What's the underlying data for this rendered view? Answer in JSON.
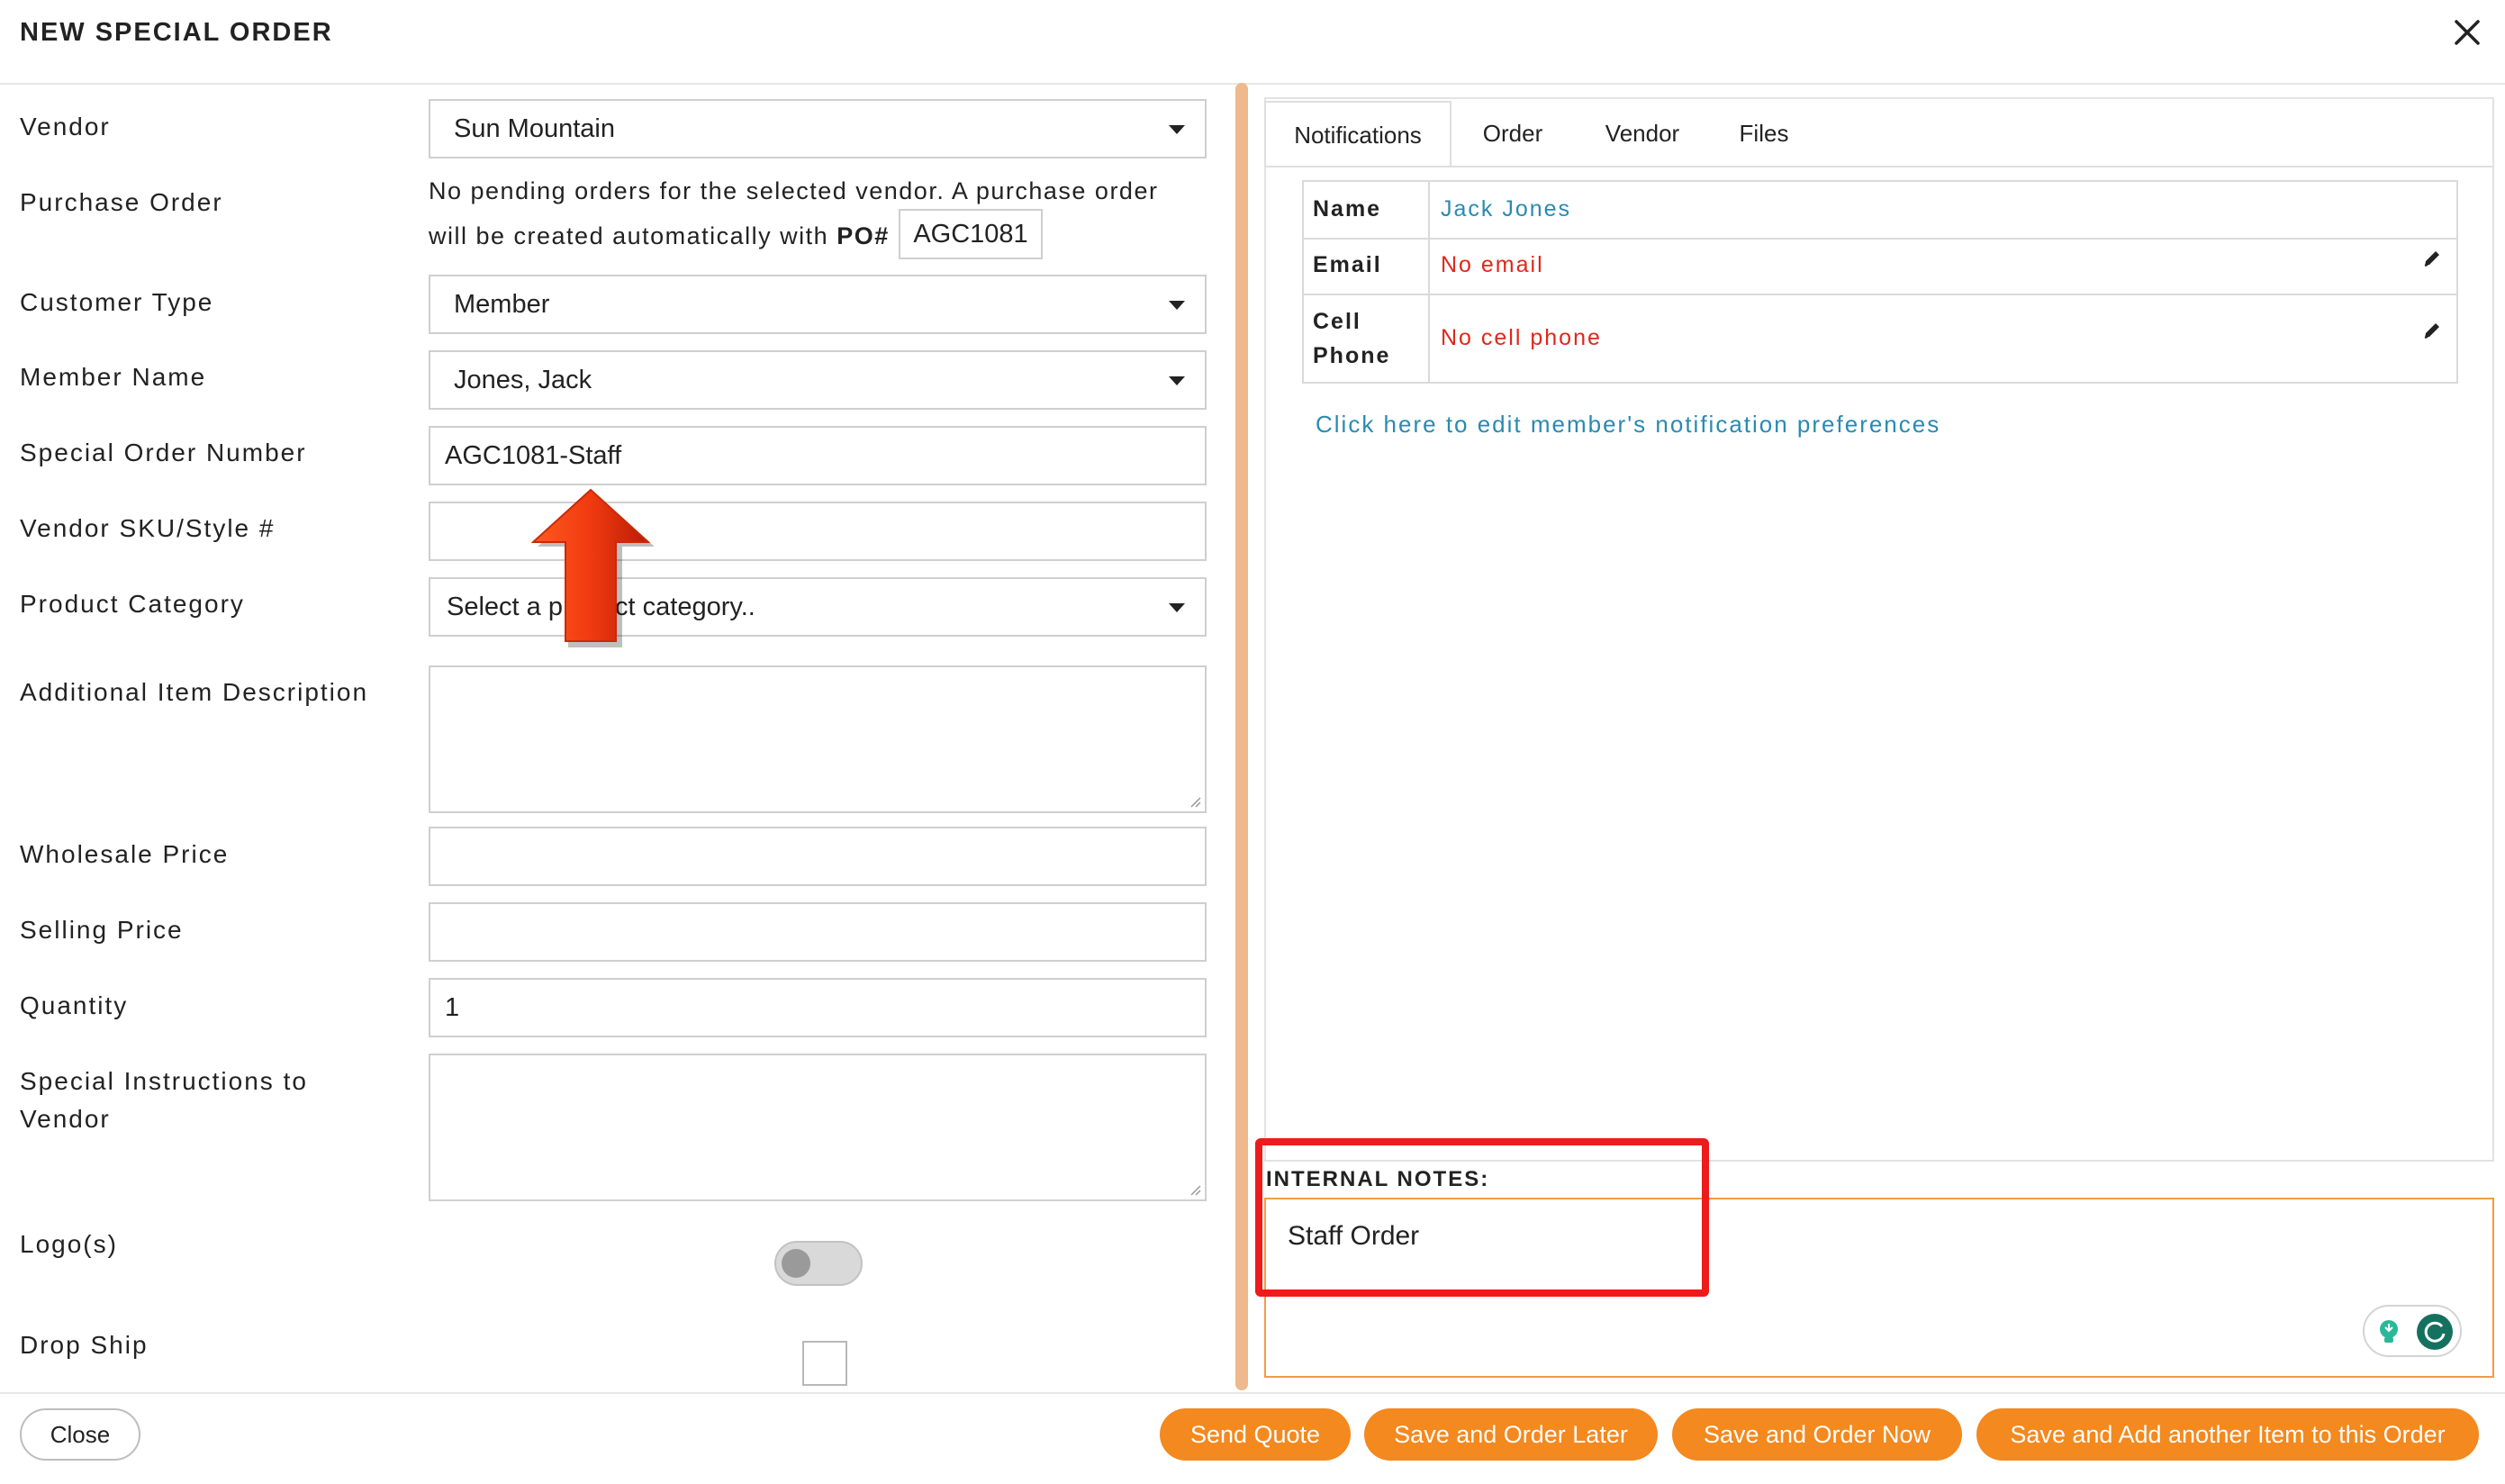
{
  "header": {
    "title": "NEW SPECIAL ORDER"
  },
  "form": {
    "vendor": {
      "label": "Vendor",
      "value": "Sun Mountain"
    },
    "purchase_order": {
      "label": "Purchase Order",
      "text_line1": "No pending orders for the selected vendor. A purchase order",
      "text_line2": "will be created automatically with",
      "po_prefix": "PO#",
      "po_number": "AGC1081"
    },
    "customer_type": {
      "label": "Customer Type",
      "value": "Member"
    },
    "member_name": {
      "label": "Member Name",
      "value": "Jones, Jack"
    },
    "special_order_number": {
      "label": "Special Order Number",
      "value": "AGC1081-Staff"
    },
    "vendor_sku": {
      "label": "Vendor SKU/Style #",
      "value": ""
    },
    "product_category": {
      "label": "Product Category",
      "placeholder": "Select a product category.."
    },
    "additional_description": {
      "label": "Additional Item Description",
      "value": ""
    },
    "wholesale_price": {
      "label": "Wholesale Price",
      "value": ""
    },
    "selling_price": {
      "label": "Selling Price",
      "value": ""
    },
    "quantity": {
      "label": "Quantity",
      "value": "1"
    },
    "special_instructions": {
      "label_line1": "Special Instructions to",
      "label_line2": "Vendor",
      "value": ""
    },
    "logos": {
      "label": "Logo(s)",
      "enabled": false
    },
    "drop_ship": {
      "label": "Drop Ship",
      "checked": false
    }
  },
  "tabs": [
    {
      "label": "Notifications",
      "active": true
    },
    {
      "label": "Order",
      "active": false
    },
    {
      "label": "Vendor",
      "active": false
    },
    {
      "label": "Files",
      "active": false
    }
  ],
  "notifications": {
    "name": {
      "key": "Name",
      "value": "Jack Jones"
    },
    "email": {
      "key": "Email",
      "value": "No email"
    },
    "cell": {
      "key_line1": "Cell",
      "key_line2": "Phone",
      "value": "No cell phone"
    },
    "edit_link": "Click here to edit member's notification preferences"
  },
  "internal_notes": {
    "label": "INTERNAL NOTES:",
    "value": "Staff Order"
  },
  "footer": {
    "close": "Close",
    "send_quote": "Send Quote",
    "save_order_later": "Save and Order Later",
    "save_order_now": "Save and Order Now",
    "save_add_another": "Save and Add another Item to this Order"
  },
  "colors": {
    "accent": "#f3891f",
    "link": "#2a8ab0",
    "error": "#e0271b",
    "annotation": "#ee1b1b"
  }
}
